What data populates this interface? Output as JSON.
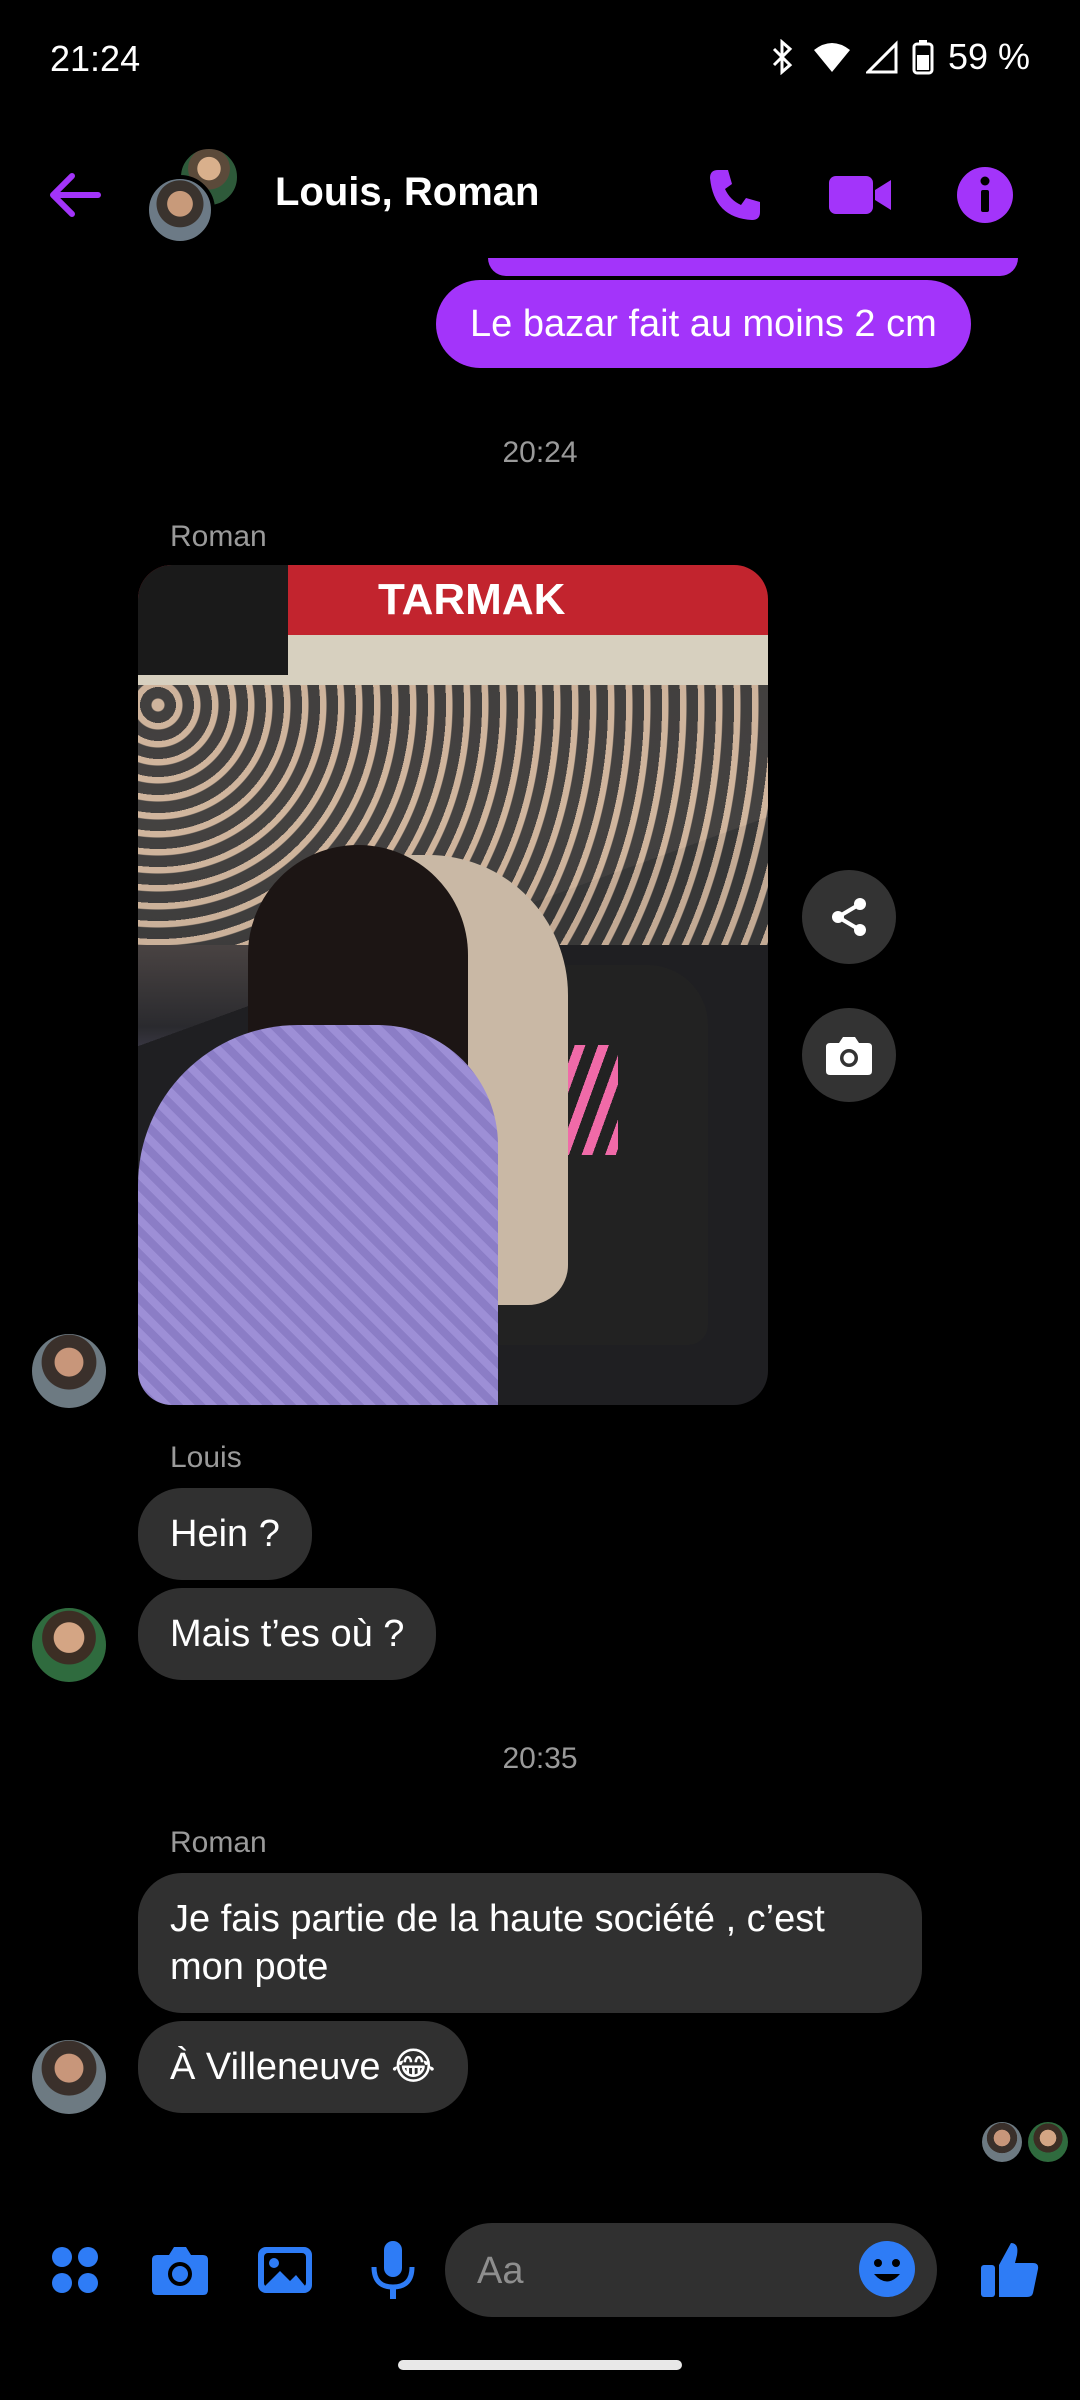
{
  "status_bar": {
    "time": "21:24",
    "battery": "59 %"
  },
  "header": {
    "title": "Louis, Roman"
  },
  "messages": {
    "outgoing_1": "Le bazar fait au moins 2 cm",
    "timestamp_1": "20:24",
    "sender_roman_1": "Roman",
    "sender_louis": "Louis",
    "louis_1": "Hein ?",
    "louis_2": "Mais t’es où ?",
    "timestamp_2": "20:35",
    "sender_roman_2": "Roman",
    "roman_2": "Je fais partie de la haute société , c’est mon pote",
    "roman_3": "À Villeneuve 😂"
  },
  "photo": {
    "banner_text": "TARMAK"
  },
  "composer": {
    "placeholder": "Aa"
  },
  "colors": {
    "accent": "#a334fa",
    "composer_blue": "#2e7cf6"
  },
  "icons": [
    "back-arrow-icon",
    "phone-icon",
    "video-icon",
    "info-icon",
    "share-icon",
    "camera-icon",
    "apps-icon",
    "image-icon",
    "mic-icon",
    "emoji-icon",
    "thumbs-up-icon"
  ]
}
